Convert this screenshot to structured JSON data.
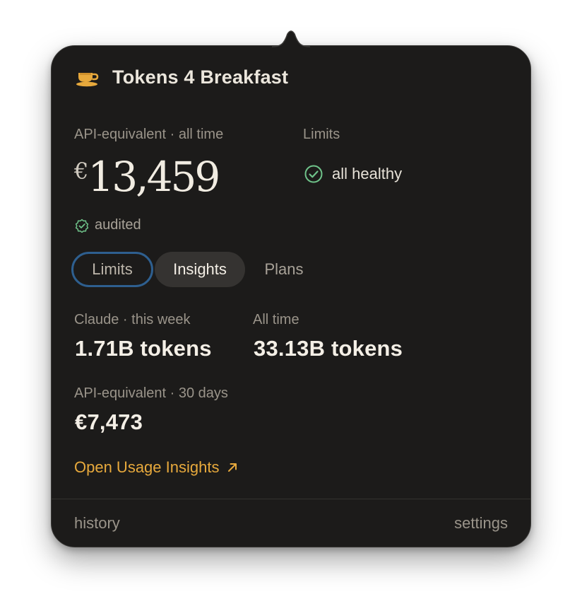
{
  "app": {
    "title": "Tokens 4 Breakfast",
    "icon": "coffee-cup-icon"
  },
  "summary": {
    "spend_label": "API-equivalent · all time",
    "currency": "€",
    "amount": "13,459",
    "audited_label": "audited",
    "limits_label": "Limits",
    "limits_status": "all healthy"
  },
  "tabs": [
    {
      "label": "Limits",
      "state": "focused"
    },
    {
      "label": "Insights",
      "state": "selected"
    },
    {
      "label": "Plans",
      "state": "normal"
    }
  ],
  "insights": {
    "week_label": "Claude · this week",
    "week_value": "1.71B tokens",
    "alltime_label": "All time",
    "alltime_value": "33.13B tokens",
    "spend30_label": "API-equivalent · 30 days",
    "spend30_value": "€7,473",
    "open_link_label": "Open Usage Insights"
  },
  "footer": {
    "history_label": "history",
    "settings_label": "settings"
  },
  "colors": {
    "background": "#1c1b1a",
    "accent": "#e7a93c",
    "success": "#6fc38a",
    "focus_ring": "#2e5f8f"
  }
}
